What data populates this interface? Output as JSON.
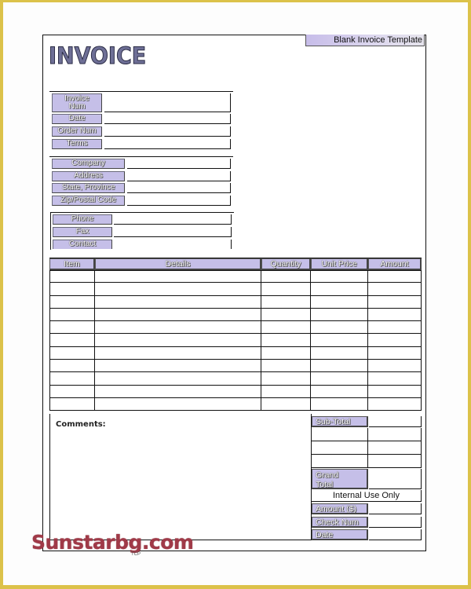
{
  "document": {
    "title": "INVOICE",
    "template_tag": "Blank Invoice Template"
  },
  "invoice_info": {
    "fields": [
      {
        "label": "Invoice Num",
        "value": ""
      },
      {
        "label": "Date",
        "value": ""
      },
      {
        "label": "Order Num",
        "value": ""
      },
      {
        "label": "Terms",
        "value": ""
      }
    ]
  },
  "company_info": {
    "fields": [
      {
        "label": "Company",
        "value": ""
      },
      {
        "label": "Address",
        "value": ""
      },
      {
        "label": "State, Province",
        "value": ""
      },
      {
        "label": "Zip/Postal Code",
        "value": ""
      }
    ]
  },
  "contact_info": {
    "fields": [
      {
        "label": "Phone",
        "value": ""
      },
      {
        "label": "Fax",
        "value": ""
      },
      {
        "label": "Contact",
        "value": ""
      }
    ]
  },
  "line_items": {
    "columns": [
      "Item",
      "Details",
      "Quantity",
      "Unit Price",
      "Amount"
    ],
    "rows": [
      [
        "",
        "",
        "",
        "",
        ""
      ],
      [
        "",
        "",
        "",
        "",
        ""
      ],
      [
        "",
        "",
        "",
        "",
        ""
      ],
      [
        "",
        "",
        "",
        "",
        ""
      ],
      [
        "",
        "",
        "",
        "",
        ""
      ],
      [
        "",
        "",
        "",
        "",
        ""
      ],
      [
        "",
        "",
        "",
        "",
        ""
      ],
      [
        "",
        "",
        "",
        "",
        ""
      ],
      [
        "",
        "",
        "",
        "",
        ""
      ],
      [
        "",
        "",
        "",
        "",
        ""
      ],
      [
        "",
        "",
        "",
        "",
        ""
      ]
    ]
  },
  "comments": {
    "label": "Comments:",
    "value": ""
  },
  "totals": {
    "subtotal_label": "Sub-Total",
    "subtotal_value": "",
    "grand_total_label": "Grand Total",
    "grand_total_value": ""
  },
  "internal_use": {
    "heading": "Internal Use Only",
    "fields": [
      {
        "label": "Amount ($)",
        "value": ""
      },
      {
        "label": "Check Num",
        "value": ""
      },
      {
        "label": "Date",
        "value": ""
      }
    ]
  },
  "watermark": {
    "text": "Sunstarbg.com",
    "small_mark": "TCP"
  },
  "colors": {
    "label_fill": "#c5bfe8",
    "title_fill": "#6e6f96",
    "frame_border": "#dcc24a",
    "watermark": "#a03a48"
  }
}
